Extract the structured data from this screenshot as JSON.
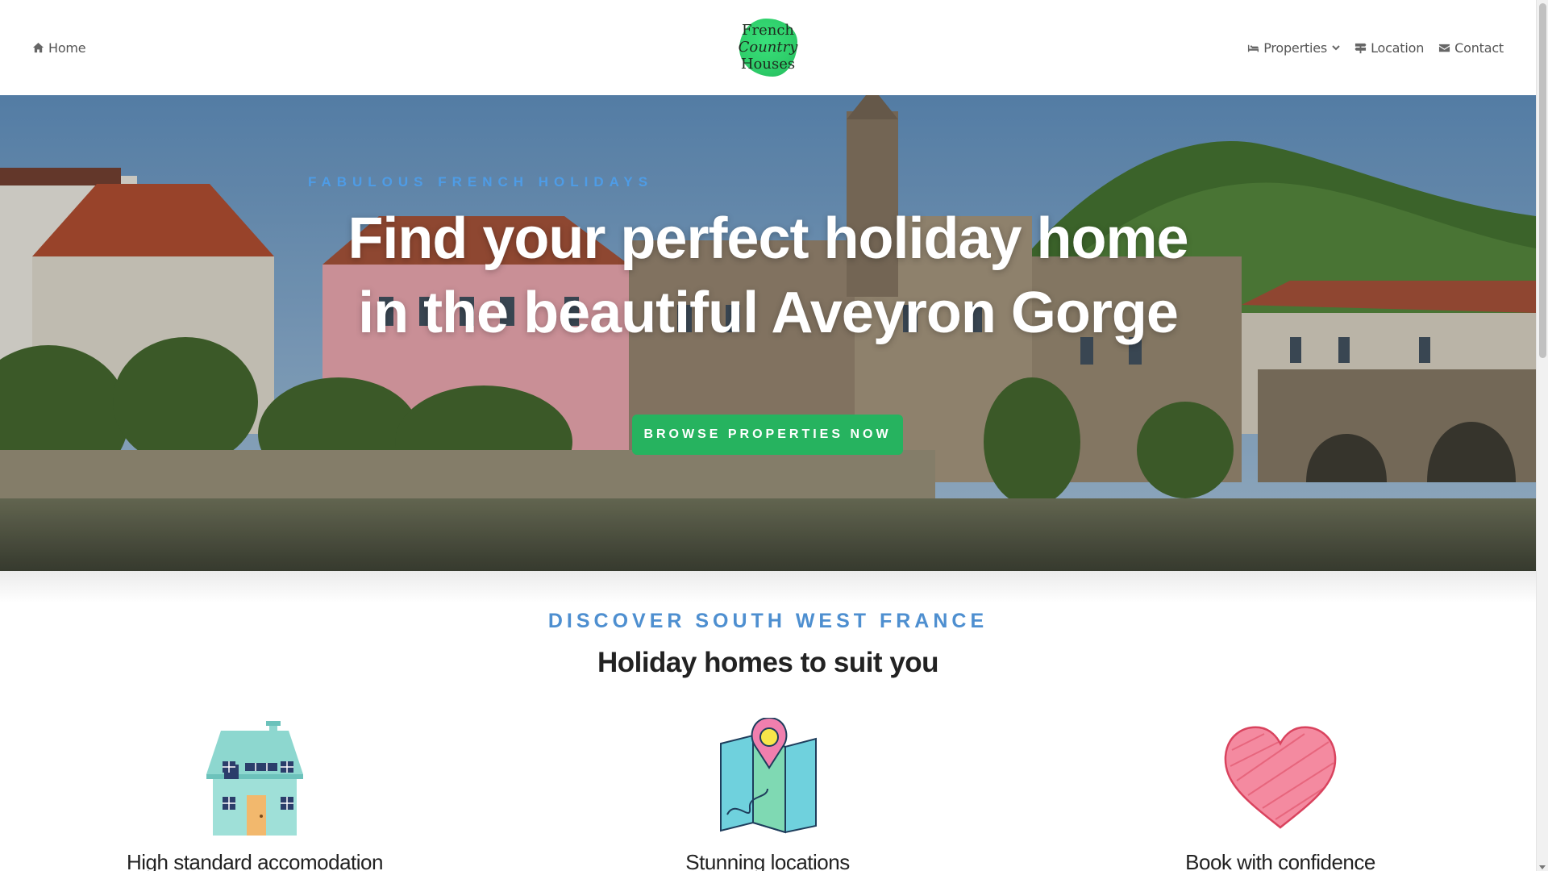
{
  "header": {
    "home_label": "Home",
    "properties_label": "Properties",
    "location_label": "Location",
    "contact_label": "Contact",
    "logo": {
      "line1": "French",
      "line2": "Country",
      "line3": "Houses",
      "color": "#2fcf6b"
    }
  },
  "hero": {
    "kicker": "FABULOUS FRENCH HOLIDAYS",
    "title_line1": "Find your perfect holiday home",
    "title_line2": "in the beautiful Aveyron Gorge",
    "button_label": "BROWSE PROPERTIES NOW",
    "button_color": "#26b35f"
  },
  "discover": {
    "kicker": "DISCOVER SOUTH WEST FRANCE",
    "title": "Holiday homes to suit you",
    "kicker_color": "#4e8fd0",
    "features": [
      {
        "title": "High standard accomodation",
        "icon": "house-icon"
      },
      {
        "title": "Stunning locations",
        "icon": "map-pin-icon"
      },
      {
        "title": "Book with confidence",
        "icon": "heart-icon"
      }
    ]
  },
  "icons": {
    "home": "home-icon",
    "properties": "bed-icon",
    "location": "signpost-icon",
    "contact": "envelope-icon",
    "dropdown": "chevron-down-icon"
  }
}
